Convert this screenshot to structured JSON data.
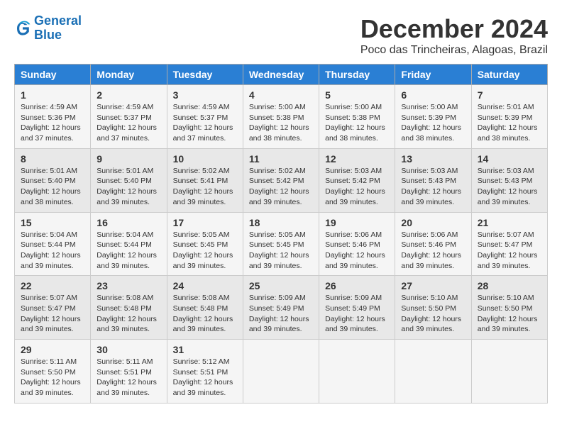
{
  "header": {
    "logo_line1": "General",
    "logo_line2": "Blue",
    "month": "December 2024",
    "location": "Poco das Trincheiras, Alagoas, Brazil"
  },
  "days_of_week": [
    "Sunday",
    "Monday",
    "Tuesday",
    "Wednesday",
    "Thursday",
    "Friday",
    "Saturday"
  ],
  "weeks": [
    [
      {
        "day": "1",
        "sunrise": "Sunrise: 4:59 AM",
        "sunset": "Sunset: 5:36 PM",
        "daylight": "Daylight: 12 hours and 37 minutes."
      },
      {
        "day": "2",
        "sunrise": "Sunrise: 4:59 AM",
        "sunset": "Sunset: 5:37 PM",
        "daylight": "Daylight: 12 hours and 37 minutes."
      },
      {
        "day": "3",
        "sunrise": "Sunrise: 4:59 AM",
        "sunset": "Sunset: 5:37 PM",
        "daylight": "Daylight: 12 hours and 37 minutes."
      },
      {
        "day": "4",
        "sunrise": "Sunrise: 5:00 AM",
        "sunset": "Sunset: 5:38 PM",
        "daylight": "Daylight: 12 hours and 38 minutes."
      },
      {
        "day": "5",
        "sunrise": "Sunrise: 5:00 AM",
        "sunset": "Sunset: 5:38 PM",
        "daylight": "Daylight: 12 hours and 38 minutes."
      },
      {
        "day": "6",
        "sunrise": "Sunrise: 5:00 AM",
        "sunset": "Sunset: 5:39 PM",
        "daylight": "Daylight: 12 hours and 38 minutes."
      },
      {
        "day": "7",
        "sunrise": "Sunrise: 5:01 AM",
        "sunset": "Sunset: 5:39 PM",
        "daylight": "Daylight: 12 hours and 38 minutes."
      }
    ],
    [
      {
        "day": "8",
        "sunrise": "Sunrise: 5:01 AM",
        "sunset": "Sunset: 5:40 PM",
        "daylight": "Daylight: 12 hours and 38 minutes."
      },
      {
        "day": "9",
        "sunrise": "Sunrise: 5:01 AM",
        "sunset": "Sunset: 5:40 PM",
        "daylight": "Daylight: 12 hours and 39 minutes."
      },
      {
        "day": "10",
        "sunrise": "Sunrise: 5:02 AM",
        "sunset": "Sunset: 5:41 PM",
        "daylight": "Daylight: 12 hours and 39 minutes."
      },
      {
        "day": "11",
        "sunrise": "Sunrise: 5:02 AM",
        "sunset": "Sunset: 5:42 PM",
        "daylight": "Daylight: 12 hours and 39 minutes."
      },
      {
        "day": "12",
        "sunrise": "Sunrise: 5:03 AM",
        "sunset": "Sunset: 5:42 PM",
        "daylight": "Daylight: 12 hours and 39 minutes."
      },
      {
        "day": "13",
        "sunrise": "Sunrise: 5:03 AM",
        "sunset": "Sunset: 5:43 PM",
        "daylight": "Daylight: 12 hours and 39 minutes."
      },
      {
        "day": "14",
        "sunrise": "Sunrise: 5:03 AM",
        "sunset": "Sunset: 5:43 PM",
        "daylight": "Daylight: 12 hours and 39 minutes."
      }
    ],
    [
      {
        "day": "15",
        "sunrise": "Sunrise: 5:04 AM",
        "sunset": "Sunset: 5:44 PM",
        "daylight": "Daylight: 12 hours and 39 minutes."
      },
      {
        "day": "16",
        "sunrise": "Sunrise: 5:04 AM",
        "sunset": "Sunset: 5:44 PM",
        "daylight": "Daylight: 12 hours and 39 minutes."
      },
      {
        "day": "17",
        "sunrise": "Sunrise: 5:05 AM",
        "sunset": "Sunset: 5:45 PM",
        "daylight": "Daylight: 12 hours and 39 minutes."
      },
      {
        "day": "18",
        "sunrise": "Sunrise: 5:05 AM",
        "sunset": "Sunset: 5:45 PM",
        "daylight": "Daylight: 12 hours and 39 minutes."
      },
      {
        "day": "19",
        "sunrise": "Sunrise: 5:06 AM",
        "sunset": "Sunset: 5:46 PM",
        "daylight": "Daylight: 12 hours and 39 minutes."
      },
      {
        "day": "20",
        "sunrise": "Sunrise: 5:06 AM",
        "sunset": "Sunset: 5:46 PM",
        "daylight": "Daylight: 12 hours and 39 minutes."
      },
      {
        "day": "21",
        "sunrise": "Sunrise: 5:07 AM",
        "sunset": "Sunset: 5:47 PM",
        "daylight": "Daylight: 12 hours and 39 minutes."
      }
    ],
    [
      {
        "day": "22",
        "sunrise": "Sunrise: 5:07 AM",
        "sunset": "Sunset: 5:47 PM",
        "daylight": "Daylight: 12 hours and 39 minutes."
      },
      {
        "day": "23",
        "sunrise": "Sunrise: 5:08 AM",
        "sunset": "Sunset: 5:48 PM",
        "daylight": "Daylight: 12 hours and 39 minutes."
      },
      {
        "day": "24",
        "sunrise": "Sunrise: 5:08 AM",
        "sunset": "Sunset: 5:48 PM",
        "daylight": "Daylight: 12 hours and 39 minutes."
      },
      {
        "day": "25",
        "sunrise": "Sunrise: 5:09 AM",
        "sunset": "Sunset: 5:49 PM",
        "daylight": "Daylight: 12 hours and 39 minutes."
      },
      {
        "day": "26",
        "sunrise": "Sunrise: 5:09 AM",
        "sunset": "Sunset: 5:49 PM",
        "daylight": "Daylight: 12 hours and 39 minutes."
      },
      {
        "day": "27",
        "sunrise": "Sunrise: 5:10 AM",
        "sunset": "Sunset: 5:50 PM",
        "daylight": "Daylight: 12 hours and 39 minutes."
      },
      {
        "day": "28",
        "sunrise": "Sunrise: 5:10 AM",
        "sunset": "Sunset: 5:50 PM",
        "daylight": "Daylight: 12 hours and 39 minutes."
      }
    ],
    [
      {
        "day": "29",
        "sunrise": "Sunrise: 5:11 AM",
        "sunset": "Sunset: 5:50 PM",
        "daylight": "Daylight: 12 hours and 39 minutes."
      },
      {
        "day": "30",
        "sunrise": "Sunrise: 5:11 AM",
        "sunset": "Sunset: 5:51 PM",
        "daylight": "Daylight: 12 hours and 39 minutes."
      },
      {
        "day": "31",
        "sunrise": "Sunrise: 5:12 AM",
        "sunset": "Sunset: 5:51 PM",
        "daylight": "Daylight: 12 hours and 39 minutes."
      },
      null,
      null,
      null,
      null
    ]
  ]
}
